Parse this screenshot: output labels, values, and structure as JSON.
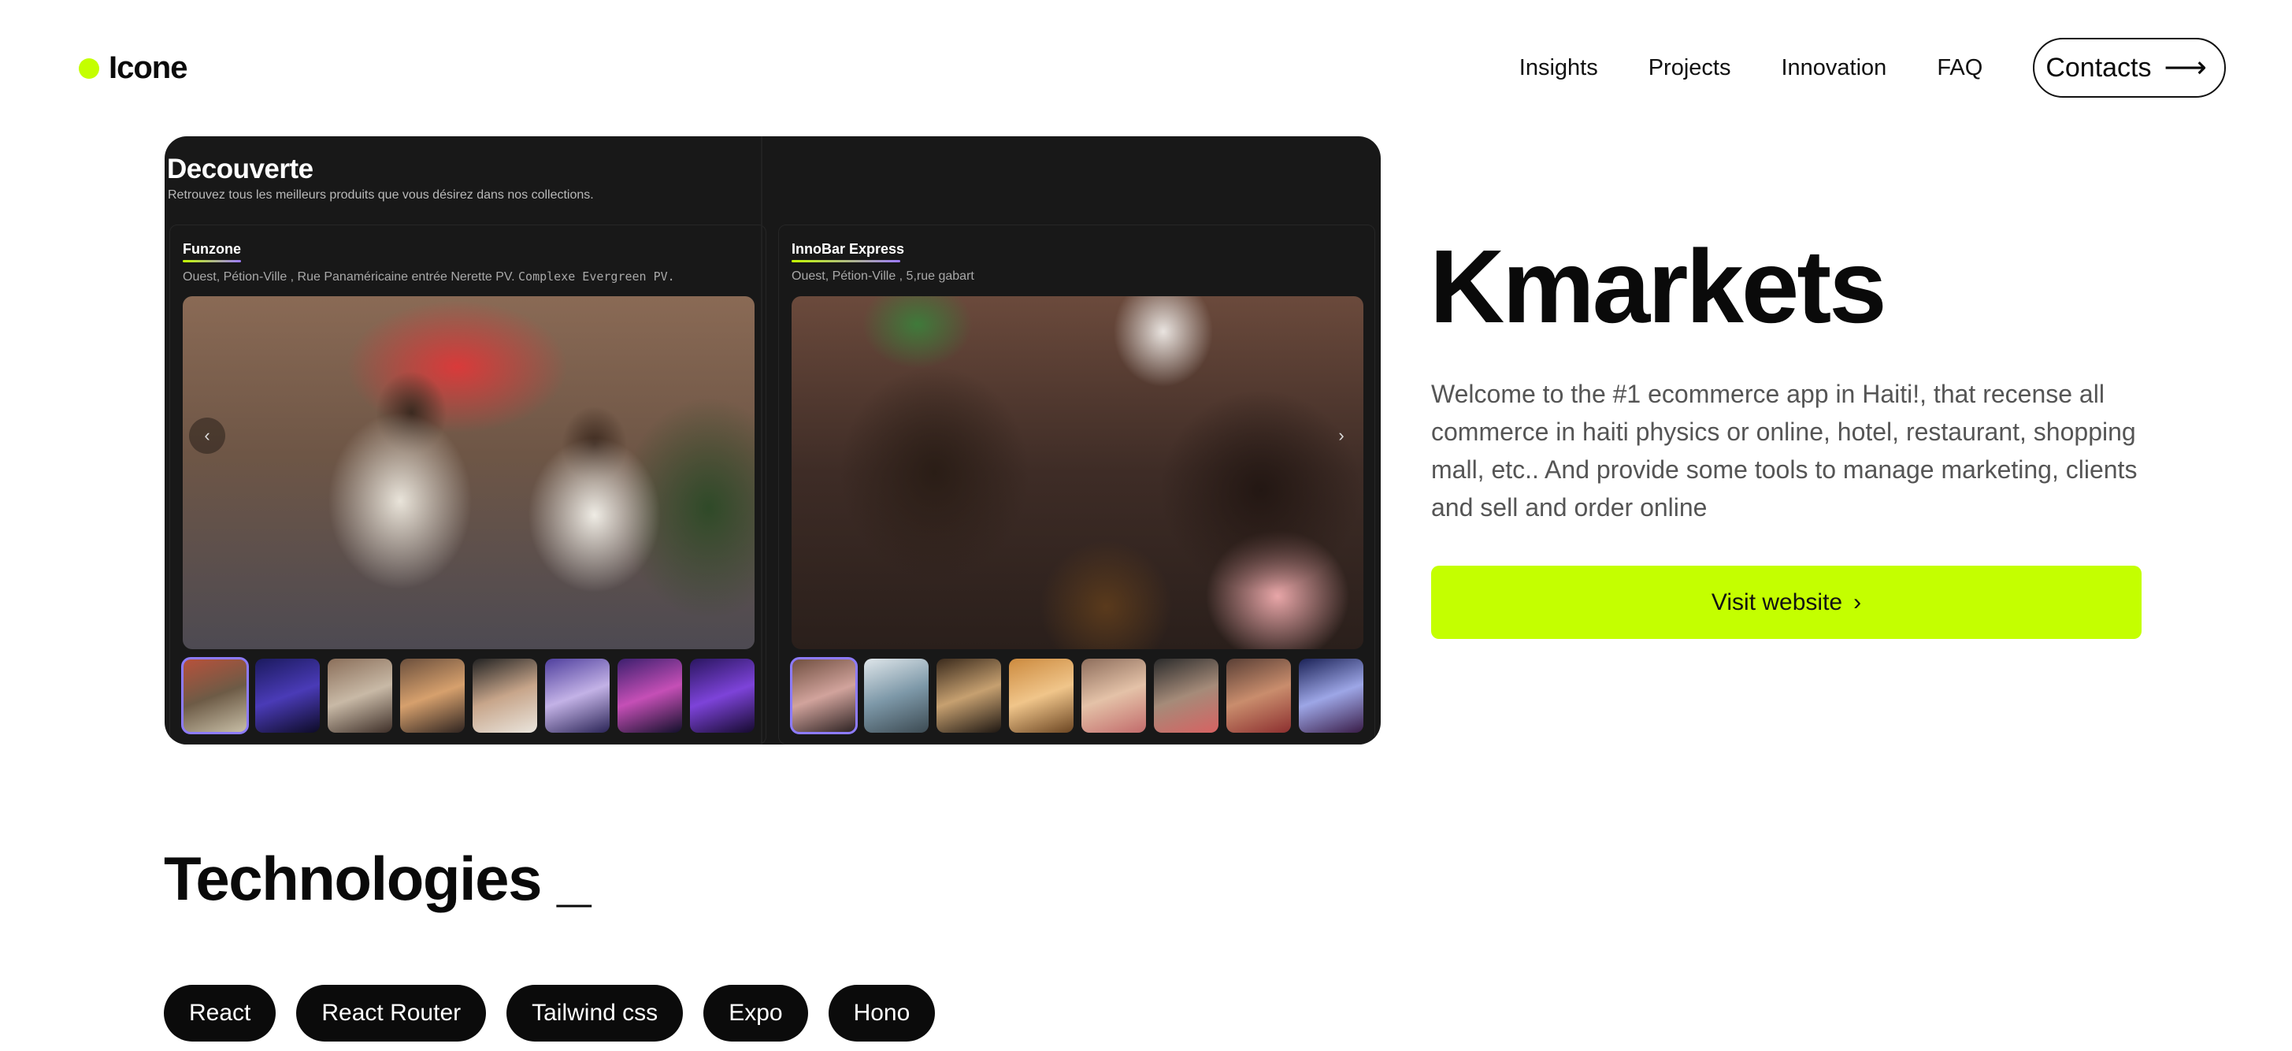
{
  "brand": {
    "name": "Icone",
    "dot_color": "#c4ff00"
  },
  "nav": {
    "links": [
      "Insights",
      "Projects",
      "Innovation",
      "FAQ"
    ],
    "contacts_label": "Contacts",
    "contacts_icon": "arrow-right-icon"
  },
  "showcase": {
    "title": "Decouverte",
    "subtitle": "Retrouvez tous les meilleurs produits que vous désirez dans nos collections.",
    "panels": [
      {
        "name": "Funzone",
        "location": "Ouest, Pétion-Ville , Rue Panaméricaine entrée Nerette PV.",
        "location_mono": "Complexe Evergreen PV."
      },
      {
        "name": "InnoBar Express",
        "location": "Ouest, Pétion-Ville , 5,rue gabart",
        "location_mono": ""
      }
    ]
  },
  "hero": {
    "title": "Kmarkets",
    "description": "Welcome to the #1 ecommerce app in Haiti!, that recense all commerce in haiti physics or online, hotel, restaurant, shopping mall, etc.. And provide some tools to manage marketing, clients and sell and order online",
    "cta_label": "Visit website",
    "cta_color": "#c4ff00"
  },
  "technologies": {
    "title": "Technologies _",
    "items": [
      "React",
      "React Router",
      "Tailwind css",
      "Expo",
      "Hono"
    ]
  }
}
